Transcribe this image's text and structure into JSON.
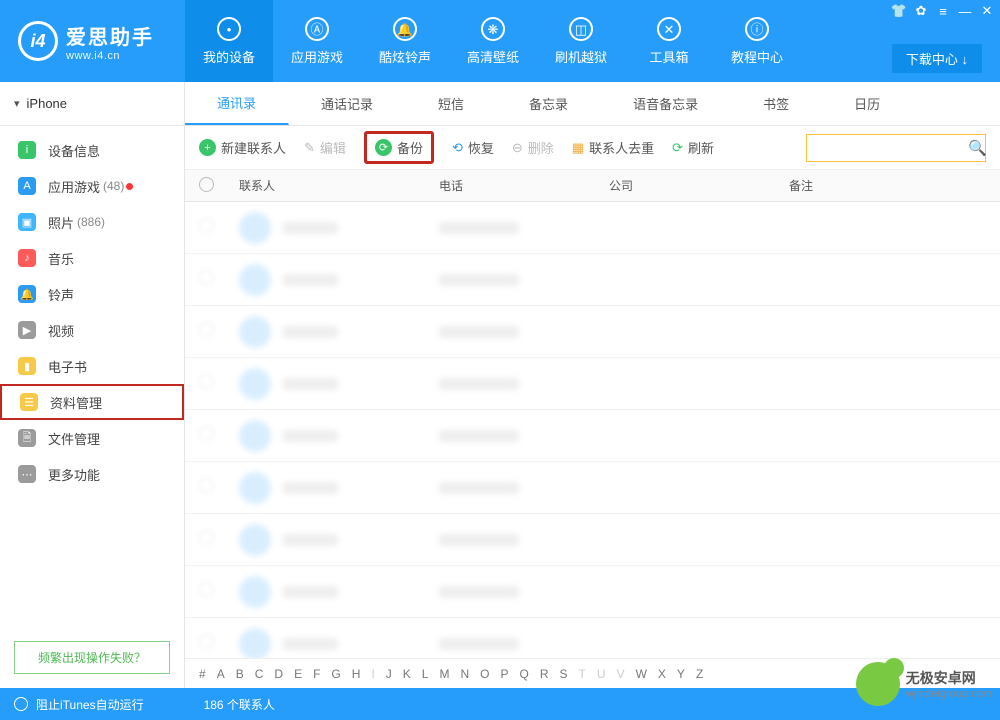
{
  "brand": {
    "cn": "爱思助手",
    "url": "www.i4.cn"
  },
  "download_center": "下载中心",
  "top_nav": [
    {
      "label": "我的设备",
      "icon": "apple"
    },
    {
      "label": "应用游戏",
      "icon": "appstore"
    },
    {
      "label": "酷炫铃声",
      "icon": "bell"
    },
    {
      "label": "高清壁纸",
      "icon": "flower"
    },
    {
      "label": "刷机越狱",
      "icon": "box"
    },
    {
      "label": "工具箱",
      "icon": "wrench"
    },
    {
      "label": "教程中心",
      "icon": "info"
    }
  ],
  "device_name": "iPhone",
  "sidebar": [
    {
      "label": "设备信息",
      "icon_bg": "#3ac569",
      "icon": "i"
    },
    {
      "label": "应用游戏",
      "icon_bg": "#2c9cf2",
      "icon": "A",
      "badge": "(48)",
      "dot": true
    },
    {
      "label": "照片",
      "icon_bg": "#3fb6ff",
      "icon": "▣",
      "badge": "(886)"
    },
    {
      "label": "音乐",
      "icon_bg": "#ff5a5a",
      "icon": "♪"
    },
    {
      "label": "铃声",
      "icon_bg": "#2c9cf2",
      "icon": "🔔"
    },
    {
      "label": "视频",
      "icon_bg": "#9b9b9b",
      "icon": "▶"
    },
    {
      "label": "电子书",
      "icon_bg": "#f7c948",
      "icon": "▮"
    },
    {
      "label": "资料管理",
      "icon_bg": "#f7c948",
      "icon": "☰",
      "active": true
    },
    {
      "label": "文件管理",
      "icon_bg": "#9b9b9b",
      "icon": "🗎"
    },
    {
      "label": "更多功能",
      "icon_bg": "#9b9b9b",
      "icon": "⋯"
    }
  ],
  "faq_btn": "频繁出现操作失败？",
  "tabs": [
    {
      "label": "通讯录",
      "active": true
    },
    {
      "label": "通话记录"
    },
    {
      "label": "短信"
    },
    {
      "label": "备忘录"
    },
    {
      "label": "语音备忘录"
    },
    {
      "label": "书签"
    },
    {
      "label": "日历"
    }
  ],
  "toolbar": {
    "new": "新建联系人",
    "edit": "编辑",
    "backup": "备份",
    "restore": "恢复",
    "delete": "删除",
    "dedup": "联系人去重",
    "refresh": "刷新",
    "search_placeholder": ""
  },
  "table": {
    "col_contact": "联系人",
    "col_phone": "电话",
    "col_company": "公司",
    "col_note": "备注"
  },
  "alpha_index": [
    "#",
    "A",
    "B",
    "C",
    "D",
    "E",
    "F",
    "G",
    "H",
    "I",
    "J",
    "K",
    "L",
    "M",
    "N",
    "O",
    "P",
    "Q",
    "R",
    "S",
    "T",
    "U",
    "V",
    "W",
    "X",
    "Y",
    "Z"
  ],
  "alpha_faded": [
    "I",
    "T",
    "U",
    "V"
  ],
  "status": {
    "itunes": "阻止iTunes自动运行",
    "count": "186 个联系人"
  },
  "watermark": {
    "cn": "无极安卓网",
    "url": "wjhotelgroup.com"
  }
}
